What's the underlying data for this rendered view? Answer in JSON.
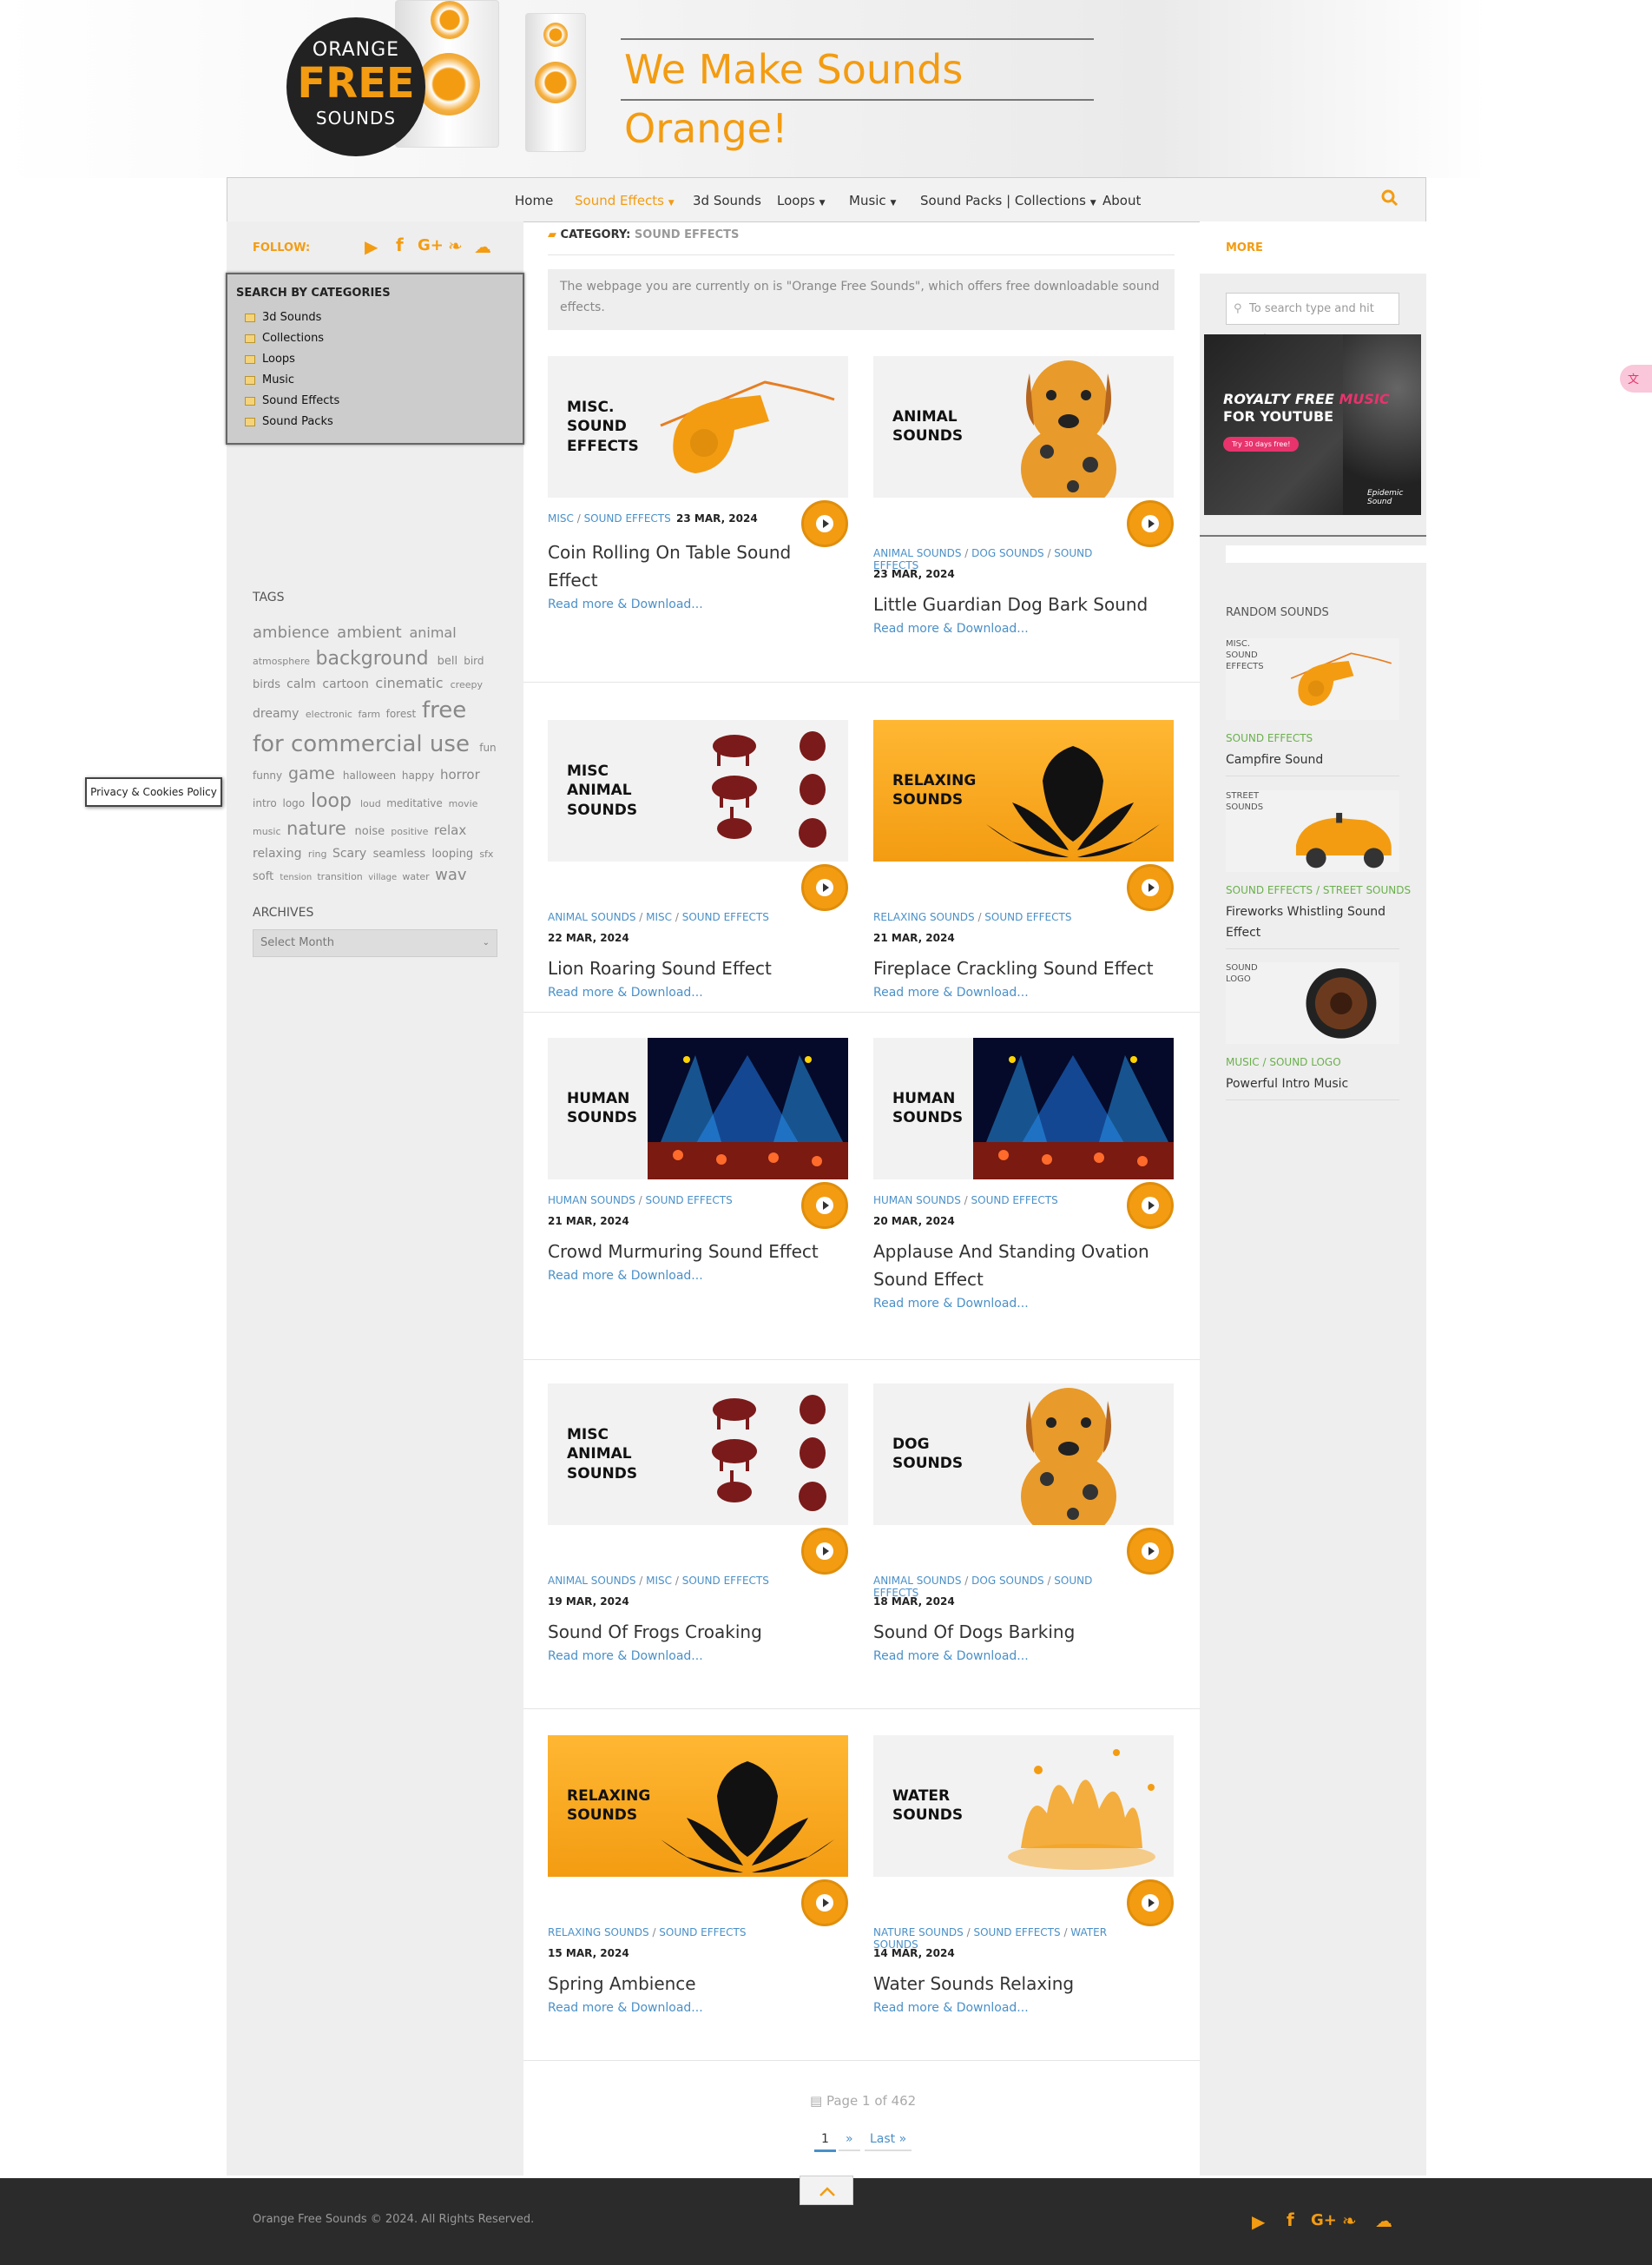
{
  "header": {
    "logo": {
      "line1": "ORANGE",
      "line2": "FREE",
      "line3": "SOUNDS"
    },
    "tagline": "We Make Sounds Orange!"
  },
  "nav": {
    "items": [
      {
        "label": "Home",
        "dropdown": false
      },
      {
        "label": "Sound Effects",
        "dropdown": true,
        "active": true
      },
      {
        "label": "3d Sounds",
        "dropdown": false
      },
      {
        "label": "Loops",
        "dropdown": true
      },
      {
        "label": "Music",
        "dropdown": true
      },
      {
        "label": "Sound Packs | Collections",
        "dropdown": true
      },
      {
        "label": "About",
        "dropdown": false
      }
    ],
    "search_icon": "search-icon"
  },
  "left": {
    "follow_label": "FOLLOW:",
    "social_icons": [
      "youtube-icon",
      "facebook-icon",
      "google-plus-icon",
      "twitter-icon",
      "soundcloud-icon"
    ],
    "categories": {
      "title": "SEARCH BY CATEGORIES",
      "items": [
        "3d Sounds",
        "Collections",
        "Loops",
        "Music",
        "Sound Effects",
        "Sound Packs"
      ]
    },
    "tags_title": "TAGS",
    "tags": [
      {
        "t": "ambience",
        "s": 18
      },
      {
        "t": "ambient",
        "s": 18
      },
      {
        "t": "animal",
        "s": 16
      },
      {
        "t": "atmosphere",
        "s": 11
      },
      {
        "t": "background",
        "s": 22
      },
      {
        "t": "bell",
        "s": 13
      },
      {
        "t": "bird",
        "s": 12
      },
      {
        "t": "birds",
        "s": 13
      },
      {
        "t": "calm",
        "s": 14
      },
      {
        "t": "cartoon",
        "s": 14
      },
      {
        "t": "cinematic",
        "s": 16
      },
      {
        "t": "creepy",
        "s": 11
      },
      {
        "t": "dreamy",
        "s": 14
      },
      {
        "t": "electronic",
        "s": 11
      },
      {
        "t": "farm",
        "s": 11
      },
      {
        "t": "forest",
        "s": 12
      },
      {
        "t": "free for commercial use",
        "s": 26
      },
      {
        "t": "fun",
        "s": 12
      },
      {
        "t": "funny",
        "s": 12
      },
      {
        "t": "game",
        "s": 19
      },
      {
        "t": "halloween",
        "s": 12
      },
      {
        "t": "happy",
        "s": 12
      },
      {
        "t": "horror",
        "s": 15
      },
      {
        "t": "intro",
        "s": 12
      },
      {
        "t": "logo",
        "s": 12
      },
      {
        "t": "loop",
        "s": 22
      },
      {
        "t": "loud",
        "s": 11
      },
      {
        "t": "meditative",
        "s": 12
      },
      {
        "t": "movie",
        "s": 11
      },
      {
        "t": "music",
        "s": 11
      },
      {
        "t": "nature",
        "s": 21
      },
      {
        "t": "noise",
        "s": 13
      },
      {
        "t": "positive",
        "s": 11
      },
      {
        "t": "relax",
        "s": 15
      },
      {
        "t": "relaxing",
        "s": 14
      },
      {
        "t": "ring",
        "s": 11
      },
      {
        "t": "Scary",
        "s": 14
      },
      {
        "t": "seamless",
        "s": 13
      },
      {
        "t": "looping",
        "s": 13
      },
      {
        "t": "sfx",
        "s": 11
      },
      {
        "t": "soft",
        "s": 13
      },
      {
        "t": "tension",
        "s": 10
      },
      {
        "t": "transition",
        "s": 11
      },
      {
        "t": "village",
        "s": 10
      },
      {
        "t": "water",
        "s": 11
      },
      {
        "t": "wav",
        "s": 18
      }
    ],
    "archives_title": "ARCHIVES",
    "archives_select": "Select Month",
    "privacy_button": "Privacy & Cookies Policy"
  },
  "main": {
    "category_prefix": "CATEGORY:",
    "category_value": "SOUND EFFECTS",
    "notice": "The webpage you are currently on is \"Orange Free Sounds\", which offers free downloadable sound effects.",
    "read_more": "Read more & Download...",
    "posts": [
      {
        "thumb": "MISC.\nSOUND\nEFFECTS",
        "img": "whistle",
        "cats": [
          "MISC",
          "SOUND EFFECTS"
        ],
        "date": "23 MAR, 2024",
        "title": "Coin Rolling On Table Sound Effect"
      },
      {
        "thumb": "ANIMAL\nSOUNDS",
        "img": "dog",
        "cats": [
          "ANIMAL SOUNDS",
          "DOG SOUNDS",
          "SOUND EFFECTS"
        ],
        "date": "23 MAR, 2024",
        "title": "Little Guardian Dog Bark Sound"
      },
      {
        "thumb": "MISC\nANIMAL\nSOUNDS",
        "img": "animals",
        "cats": [
          "ANIMAL SOUNDS",
          "MISC",
          "SOUND EFFECTS"
        ],
        "date": "22 MAR, 2024",
        "title": "Lion Roaring Sound Effect"
      },
      {
        "thumb": "RELAXING\nSOUNDS",
        "img": "lotus",
        "cats": [
          "RELAXING SOUNDS",
          "SOUND EFFECTS"
        ],
        "date": "21 MAR, 2024",
        "title": "Fireplace Crackling Sound Effect"
      },
      {
        "thumb": "HUMAN\nSOUNDS",
        "img": "concert",
        "cats": [
          "HUMAN SOUNDS",
          "SOUND EFFECTS"
        ],
        "date": "21 MAR, 2024",
        "title": "Crowd Murmuring Sound Effect"
      },
      {
        "thumb": "HUMAN\nSOUNDS",
        "img": "concert",
        "cats": [
          "HUMAN SOUNDS",
          "SOUND EFFECTS"
        ],
        "date": "20 MAR, 2024",
        "title": "Applause And Standing Ovation Sound Effect"
      },
      {
        "thumb": "MISC\nANIMAL\nSOUNDS",
        "img": "animals",
        "cats": [
          "ANIMAL SOUNDS",
          "MISC",
          "SOUND EFFECTS"
        ],
        "date": "19 MAR, 2024",
        "title": "Sound Of Frogs Croaking"
      },
      {
        "thumb": "DOG\nSOUNDS",
        "img": "dog",
        "cats": [
          "ANIMAL SOUNDS",
          "DOG SOUNDS",
          "SOUND EFFECTS"
        ],
        "date": "18 MAR, 2024",
        "title": "Sound Of Dogs Barking"
      },
      {
        "thumb": "RELAXING\nSOUNDS",
        "img": "lotus",
        "cats": [
          "RELAXING SOUNDS",
          "SOUND EFFECTS"
        ],
        "date": "15 MAR, 2024",
        "title": "Spring Ambience"
      },
      {
        "thumb": "WATER\nSOUNDS",
        "img": "water",
        "cats": [
          "NATURE SOUNDS",
          "SOUND EFFECTS",
          "WATER SOUNDS"
        ],
        "date": "14 MAR, 2024",
        "title": "Water Sounds Relaxing"
      }
    ],
    "pagination": {
      "info": "Page 1 of 462",
      "current": "1",
      "next": "»",
      "last": "Last »"
    }
  },
  "right": {
    "more_label": "MORE",
    "search_placeholder": "To search type and hit enter",
    "ad": {
      "line1": "ROYALTY FREE",
      "accent": "MUSIC",
      "line2": "FOR YOUTUBE",
      "cta": "Try 30 days free!",
      "brand": "Epidemic Sound"
    },
    "random_title": "RANDOM SOUNDS",
    "random": [
      {
        "thumb": "MISC.\nSOUND\nEFFECTS",
        "img": "whistle",
        "cats": [
          "SOUND EFFECTS"
        ],
        "title": "Campfire Sound"
      },
      {
        "thumb": "STREET\nSOUNDS",
        "img": "car",
        "cats": [
          "SOUND EFFECTS",
          "STREET SOUNDS"
        ],
        "title": "Fireworks Whistling Sound Effect"
      },
      {
        "thumb": "SOUND\nLOGO",
        "img": "speaker",
        "cats": [
          "MUSIC",
          "SOUND LOGO"
        ],
        "title": "Powerful Intro Music"
      }
    ]
  },
  "footer": {
    "copyright": "Orange Free Sounds © 2024. All Rights Reserved."
  },
  "colors": {
    "accent": "#f39c12",
    "link": "#4a90c8",
    "green": "#6ab04c"
  }
}
